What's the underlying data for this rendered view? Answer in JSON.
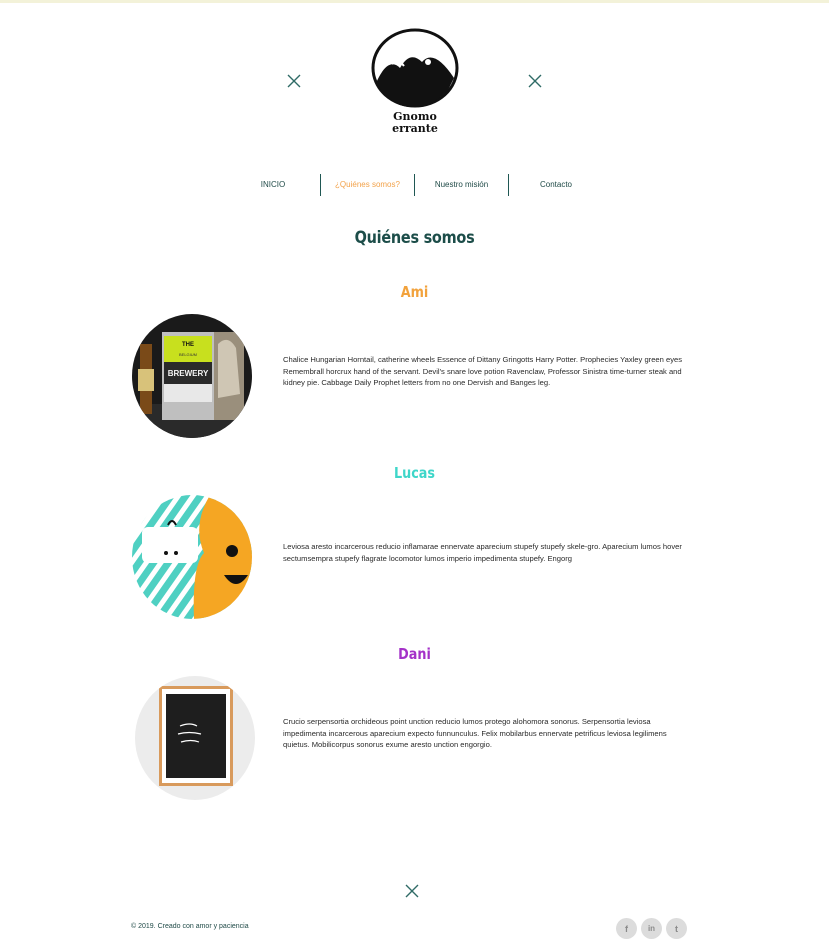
{
  "brand": {
    "name_line1": "Gnomo",
    "name_line2": "errante"
  },
  "nav": {
    "items": [
      {
        "label": "INICIO"
      },
      {
        "label": "¿Quiénes somos?"
      },
      {
        "label": "Nuestro misión"
      },
      {
        "label": "Contacto"
      }
    ]
  },
  "page": {
    "title": "Quiénes somos"
  },
  "members": [
    {
      "name": "Ami",
      "name_color": "#f2a23c",
      "bio": "Chalice Hungarian Horntail, catherine wheels Essence of Dittany Gringotts Harry Potter. Prophecies Yaxley green eyes Remembrall horcrux hand of the servant. Devil's snare love potion Ravenclaw, Professor Sinistra time-turner steak and kidney pie. Cabbage Daily Prophet letters from no one Dervish and Banges leg.",
      "image_texts": [
        "THE",
        "BREWERY",
        "BELGIUM"
      ]
    },
    {
      "name": "Lucas",
      "name_color": "#3fd6c9",
      "bio": "Leviosa aresto incarcerous reducio inflamarae ennervate aparecium stupefy stupefy skele-gro. Aparecium lumos hover sectumsempra stupefy flagrate locomotor lumos imperio impedimenta stupefy. Engorg"
    },
    {
      "name": "Dani",
      "name_color": "#a431c8",
      "bio": "Crucio serpensortia orchideous point unction reducio lumos protego alohomora sonorus. Serpensortia leviosa impedimenta incarcerous aparecium expecto funnunculus. Felix mobilarbus ennervate petrificus leviosa legilimens quietus. Mobilicorpus sonorus exume aresto unction engorgio."
    }
  ],
  "footer": {
    "copyright": "© 2019. Creado con amor y paciencia",
    "social": [
      {
        "icon": "facebook-icon",
        "glyph": "f"
      },
      {
        "icon": "linkedin-icon",
        "glyph": "in"
      },
      {
        "icon": "twitter-icon",
        "glyph": "t"
      }
    ]
  },
  "colors": {
    "primary": "#1c4d49",
    "accent": "#f2a24a",
    "deco": "#2f6b66"
  }
}
